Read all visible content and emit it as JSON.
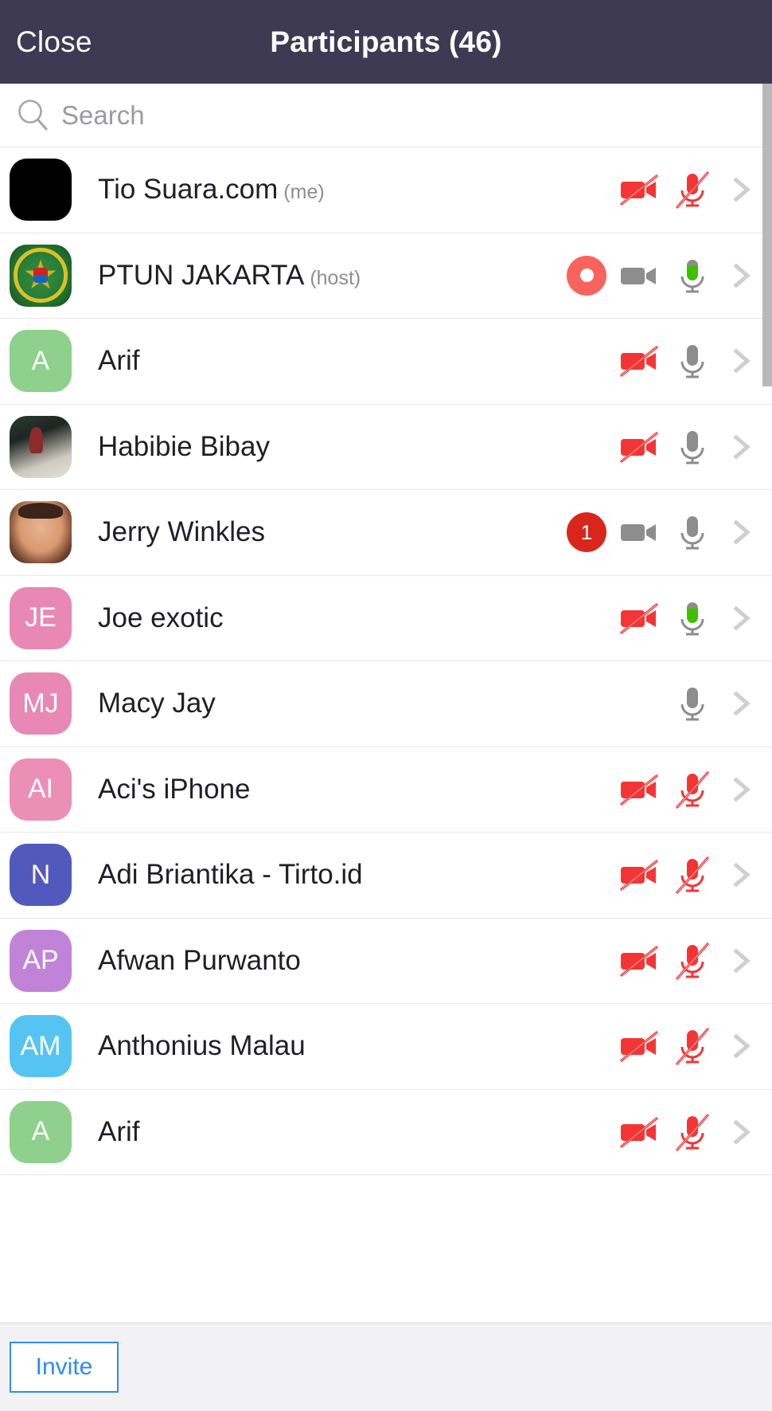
{
  "header": {
    "close_label": "Close",
    "title": "Participants (46)",
    "background_color": "#3e3a54"
  },
  "search": {
    "placeholder": "Search",
    "value": "",
    "icon": "search-icon"
  },
  "participants": [
    {
      "name": "Tio Suara.com",
      "suffix": "(me)",
      "avatar_type": "photo",
      "avatar_class": "black",
      "avatar_initials": "",
      "camera": "off",
      "mic": "muted",
      "badge": null
    },
    {
      "name": "PTUN JAKARTA",
      "suffix": "(host)",
      "avatar_type": "logo",
      "avatar_class": "logo-ptun",
      "avatar_initials": "",
      "camera": "on",
      "mic": "active",
      "badge": "recording"
    },
    {
      "name": "Arif",
      "suffix": "",
      "avatar_type": "initials",
      "avatar_color": "#8ed08c",
      "avatar_initials": "A",
      "camera": "off",
      "mic": "on",
      "badge": null
    },
    {
      "name": "Habibie Bibay",
      "suffix": "",
      "avatar_type": "photo",
      "avatar_class": "photo-habibie",
      "avatar_initials": "",
      "camera": "off",
      "mic": "on",
      "badge": null
    },
    {
      "name": "Jerry Winkles",
      "suffix": "",
      "avatar_type": "photo",
      "avatar_class": "photo-jerry",
      "avatar_initials": "",
      "camera": "on",
      "mic": "on",
      "badge": "1"
    },
    {
      "name": "Joe exotic",
      "suffix": "",
      "avatar_type": "initials",
      "avatar_color": "#e888b4",
      "avatar_initials": "JE",
      "camera": "off",
      "mic": "active",
      "badge": null
    },
    {
      "name": "Macy Jay",
      "suffix": "",
      "avatar_type": "initials",
      "avatar_color": "#e888b4",
      "avatar_initials": "MJ",
      "camera": "none",
      "mic": "on",
      "badge": null
    },
    {
      "name": "Aci's iPhone",
      "suffix": "",
      "avatar_type": "initials",
      "avatar_color": "#ec8fb6",
      "avatar_initials": "AI",
      "camera": "off",
      "mic": "muted",
      "badge": null
    },
    {
      "name": "Adi Briantika - Tirto.id",
      "suffix": "",
      "avatar_type": "initials",
      "avatar_color": "#5259bd",
      "avatar_initials": "N",
      "camera": "off",
      "mic": "muted",
      "badge": null
    },
    {
      "name": "Afwan Purwanto",
      "suffix": "",
      "avatar_type": "initials",
      "avatar_color": "#c183d8",
      "avatar_initials": "AP",
      "camera": "off",
      "mic": "muted",
      "badge": null
    },
    {
      "name": "Anthonius Malau",
      "suffix": "",
      "avatar_type": "initials",
      "avatar_color": "#56c4f2",
      "avatar_initials": "AM",
      "camera": "off",
      "mic": "muted",
      "badge": null
    },
    {
      "name": "Arif",
      "suffix": "",
      "avatar_type": "initials",
      "avatar_color": "#8ed08c",
      "avatar_initials": "A",
      "camera": "off",
      "mic": "muted",
      "badge": null
    }
  ],
  "footer": {
    "invite_label": "Invite",
    "accent_color": "#2d8cf0"
  },
  "colors": {
    "camera_off": "#f43535",
    "mic_muted": "#f43535",
    "device_on": "#8d8d8d",
    "mic_active": "#3ec000",
    "recording": "#f9635e",
    "badge": "#d9261c",
    "chevron": "#cfcfd2"
  }
}
